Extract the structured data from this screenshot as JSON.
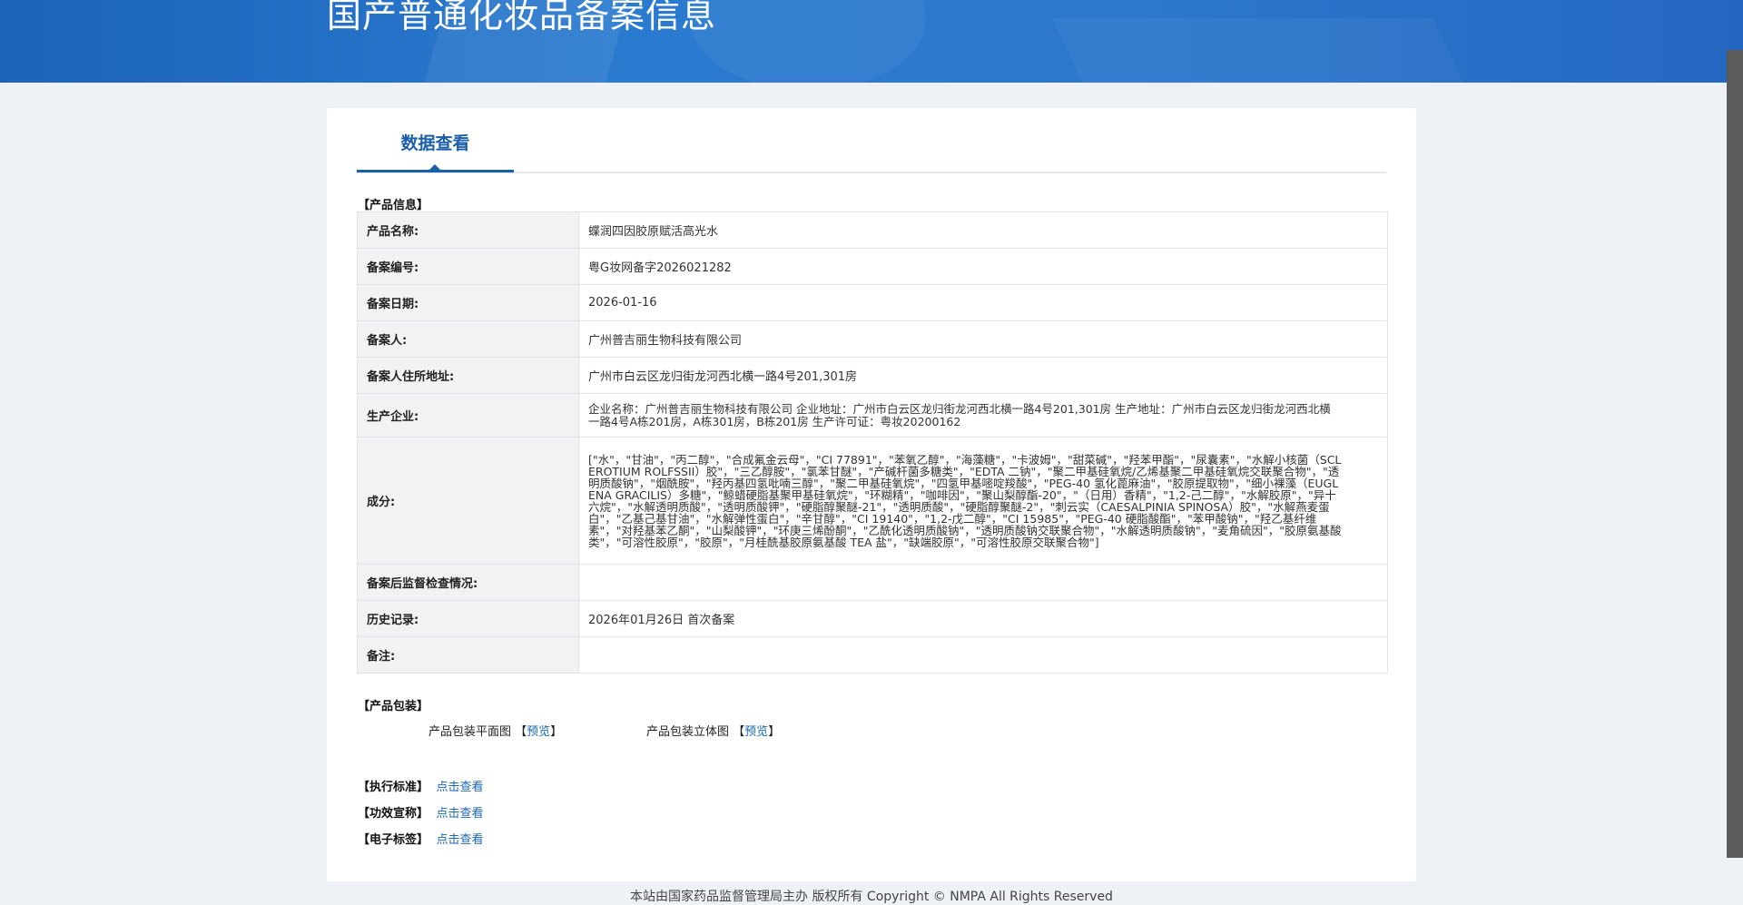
{
  "header": {
    "title": "国产普通化妆品备案信息"
  },
  "tabs": [
    {
      "label": "数据查看"
    }
  ],
  "sections": {
    "product_info": "【产品信息】",
    "product_package": "【产品包装】",
    "standard": "【执行标准】",
    "efficacy": "【功效宣称】",
    "elabel": "【电子标签】"
  },
  "product": {
    "rows": [
      {
        "label": "产品名称:",
        "value": "蝶润四因胶原赋活高光水"
      },
      {
        "label": "备案编号:",
        "value": "粤G妆网备字2026021282"
      },
      {
        "label": "备案日期:",
        "value": "2026-01-16"
      },
      {
        "label": "备案人:",
        "value": "广州普吉丽生物科技有限公司"
      },
      {
        "label": "备案人住所地址:",
        "value": "广州市白云区龙归街龙河西北横一路4号201,301房"
      },
      {
        "label": "生产企业:",
        "value": "企业名称：广州普吉丽生物科技有限公司 企业地址：广州市白云区龙归街龙河西北横一路4号201,301房 生产地址：广州市白云区龙归街龙河西北横一路4号A栋201房，A栋301房，B栋201房 生产许可证：粤妆20200162"
      },
      {
        "label": "成分:",
        "value": "[\"水\"，\"甘油\"，\"丙二醇\"，\"合成氟金云母\"，\"CI 77891\"，\"苯氧乙醇\"，\"海藻糖\"，\"卡波姆\"，\"甜菜碱\"，\"羟苯甲酯\"，\"尿囊素\"，\"水解小核菌（SCLEROTIUM ROLFSSII）胶\"，\"三乙醇胺\"，\"氯苯甘醚\"，\"产碱杆菌多糖类\"，\"EDTA 二钠\"，\"聚二甲基硅氧烷/乙烯基聚二甲基硅氧烷交联聚合物\"，\"透明质酸钠\"，\"烟酰胺\"，\"羟丙基四氢吡喃三醇\"，\"聚二甲基硅氧烷\"，\"四氢甲基嘧啶羧酸\"，\"PEG-40 氢化蓖麻油\"，\"胶原提取物\"，\"细小裸藻（EUGLENA GRACILIS）多糖\"，\"鲸蜡硬脂基聚甲基硅氧烷\"，\"环糊精\"，\"咖啡因\"，\"聚山梨醇酯-20\"，\"（日用）香精\"，\"1,2-己二醇\"，\"水解胶原\"，\"异十六烷\"，\"水解透明质酸\"，\"透明质酸钾\"，\"硬脂醇聚醚-21\"，\"透明质酸\"，\"硬脂醇聚醚-2\"，\"刺云实（CAESALPINIA SPINOSA）胶\"，\"水解燕麦蛋白\"，\"乙基己基甘油\"，\"水解弹性蛋白\"，\"辛甘醇\"，\"CI 19140\"，\"1,2-戊二醇\"，\"CI 15985\"，\"PEG-40 硬脂酸酯\"，\"苯甲酸钠\"，\"羟乙基纤维素\"，\"对羟基苯乙酮\"，\"山梨酸钾\"，\"环庚三烯酚酮\"，\"乙酰化透明质酸钠\"，\"透明质酸钠交联聚合物\"，\"水解透明质酸钠\"，\"麦角硫因\"，\"胶原氨基酸类\"，\"可溶性胶原\"，\"胶原\"，\"月桂酰基胶原氨基酸 TEA 盐\"，\"缺端胶原\"，\"可溶性胶原交联聚合物\"]"
      },
      {
        "label": "备案后监督检查情况:",
        "value": ""
      },
      {
        "label": "历史记录:",
        "value": "2026年01月26日 首次备案"
      },
      {
        "label": "备注:",
        "value": ""
      }
    ]
  },
  "package": {
    "flat_label": "产品包装平面图",
    "solid_label": "产品包装立体图",
    "preview_link": "预览",
    "bracket_open": "【",
    "bracket_close": "】"
  },
  "links": {
    "view": "点击查看"
  },
  "footer": {
    "text": "本站由国家药品监督管理局主办 版权所有 Copyright © NMPA All Rights Reserved"
  }
}
